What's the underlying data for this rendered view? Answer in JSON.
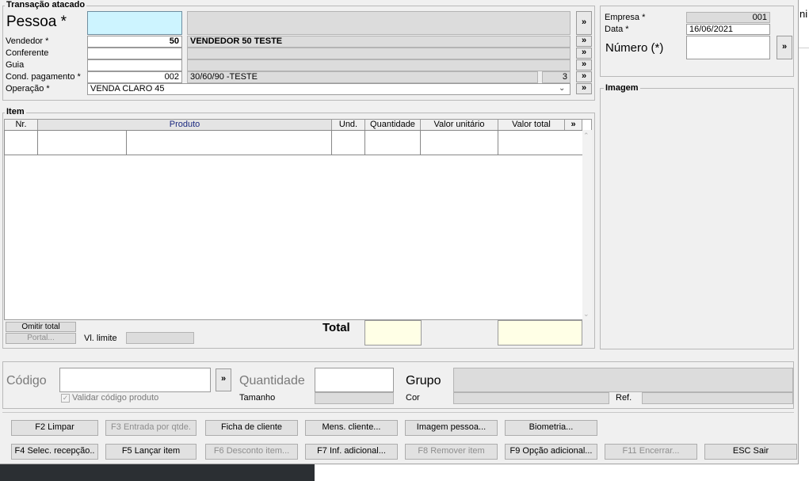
{
  "transacao": {
    "title": "Transação atacado",
    "pessoa_label": "Pessoa *",
    "pessoa_value": "",
    "pessoa_name": "",
    "vendedor_label": "Vendedor *",
    "vendedor_code": "50",
    "vendedor_name": "VENDEDOR 50 TESTE",
    "conferente_label": "Conferente",
    "guia_label": "Guia",
    "cond_label": "Cond. pagamento *",
    "cond_code": "002",
    "cond_desc": "30/60/90 -TESTE",
    "cond_count": "3",
    "operacao_label": "Operação *",
    "operacao_value": "VENDA CLARO 45",
    "more": "»"
  },
  "right_panel": {
    "empresa_label": "Empresa *",
    "empresa_value": "001",
    "data_label": "Data *",
    "data_value": "16/06/2021",
    "numero_label": "Número (*)",
    "more": "»",
    "imagem_title": "Imagem"
  },
  "item": {
    "title": "Item",
    "columns": [
      "Nr.",
      "Produto",
      "Und.",
      "Quantidade",
      "Valor unitário",
      "Valor total",
      "»"
    ],
    "omitir_total": "Omitir total",
    "portal": "Portal...",
    "vl_limite": "Vl. limite",
    "total_label": "Total"
  },
  "entry": {
    "codigo_label": "Código",
    "more": "»",
    "quantidade_label": "Quantidade",
    "grupo_label": "Grupo",
    "validar_label": "Validar código produto",
    "tamanho_label": "Tamanho",
    "cor_label": "Cor",
    "ref_label": "Ref."
  },
  "buttons": {
    "row1": [
      "F2 Limpar",
      "F3 Entrada por qtde.",
      "Ficha de cliente",
      "Mens. cliente...",
      "Imagem pessoa...",
      "Biometria..."
    ],
    "row2": [
      "F4 Selec. recepção..",
      "F5 Lançar item",
      "F6 Desconto item...",
      "F7 Inf. adicional...",
      "F8 Remover item",
      "F9 Opção adicional...",
      "F11 Encerrar...",
      "ESC Sair"
    ]
  },
  "edge_text": "ni"
}
